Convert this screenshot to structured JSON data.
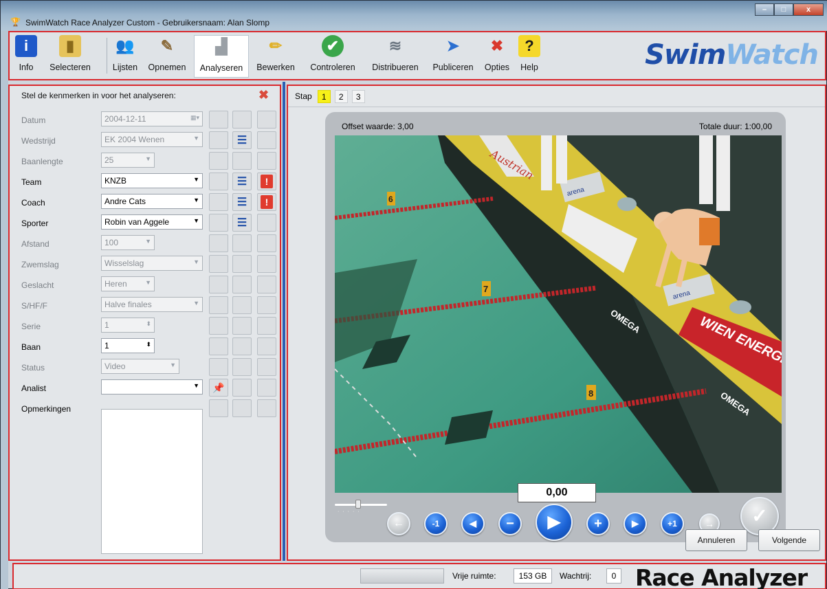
{
  "window": {
    "title": "SwimWatch Race Analyzer Custom - Gebruikersnaam: Alan Slomp",
    "min_glyph": "–",
    "max_glyph": "□",
    "close_glyph": "x"
  },
  "toolbar": {
    "items": [
      {
        "label": "Info",
        "icon": "info-icon"
      },
      {
        "label": "Selecteren",
        "icon": "folder-icon"
      },
      {
        "label": "Lijsten",
        "icon": "people-icon"
      },
      {
        "label": "Opnemen",
        "icon": "camera-icon"
      },
      {
        "label": "Analyseren",
        "icon": "podium-icon"
      },
      {
        "label": "Bewerken",
        "icon": "pencil-icon"
      },
      {
        "label": "Controleren",
        "icon": "shield-check-icon"
      },
      {
        "label": "Distribueren",
        "icon": "stack-icon"
      },
      {
        "label": "Publiceren",
        "icon": "publish-icon"
      },
      {
        "label": "Opties",
        "icon": "tools-icon"
      },
      {
        "label": "Help",
        "icon": "help-icon"
      }
    ],
    "logo_a": "Swim",
    "logo_b": "Watch"
  },
  "left": {
    "title": "Stel de kenmerken in voor het analyseren:",
    "fields": [
      {
        "label": "Datum",
        "value": "2004-12-11",
        "enabled": false
      },
      {
        "label": "Wedstrijd",
        "value": "EK 2004 Wenen",
        "enabled": false
      },
      {
        "label": "Baanlengte",
        "value": "25",
        "enabled": false
      },
      {
        "label": "Team",
        "value": "KNZB",
        "enabled": true
      },
      {
        "label": "Coach",
        "value": "Andre Cats",
        "enabled": true
      },
      {
        "label": "Sporter",
        "value": "Robin van Aggele",
        "enabled": true
      },
      {
        "label": "Afstand",
        "value": "100",
        "enabled": false
      },
      {
        "label": "Zwemslag",
        "value": "Wisselslag",
        "enabled": false
      },
      {
        "label": "Geslacht",
        "value": "Heren",
        "enabled": false
      },
      {
        "label": "S/HF/F",
        "value": "Halve finales",
        "enabled": false
      },
      {
        "label": "Serie",
        "value": "1",
        "enabled": false
      },
      {
        "label": "Baan",
        "value": "1",
        "enabled": true
      },
      {
        "label": "Status",
        "value": "Video",
        "enabled": false
      },
      {
        "label": "Analist",
        "value": "",
        "enabled": true
      },
      {
        "label": "Opmerkingen",
        "value": "",
        "enabled": true
      }
    ]
  },
  "right": {
    "step_label": "Stap",
    "steps": [
      "1",
      "2",
      "3"
    ],
    "active_step": "1",
    "offset_text": "Offset waarde: 3,00",
    "total_text": "Totale duur: 1:00,00",
    "time": "0,00",
    "cancel_label": "Annuleren",
    "next_label": "Volgende",
    "video_texts": {
      "lane6": "6",
      "lane7": "7",
      "lane8": "8",
      "austrian": "Austrian",
      "omega": "OMEGA",
      "arena": "arena",
      "wien": "WIEN ENERGIE"
    }
  },
  "status": {
    "free_label": "Vrije ruimte:",
    "free_value": "153 GB",
    "queue_label": "Wachtrij:",
    "queue_value": "0",
    "brand": "Race Analyzer"
  },
  "colors": {
    "accent_red": "#d9282d",
    "divider_blue": "#2b5fb3",
    "active_step": "#f7f019",
    "button_blue": "#1c63d6"
  }
}
